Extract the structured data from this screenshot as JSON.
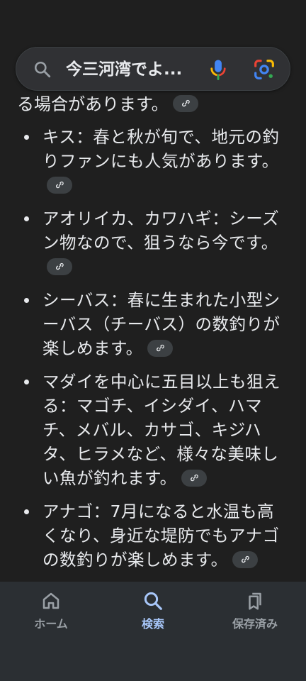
{
  "search": {
    "query": "今三河湾でよ..."
  },
  "content": {
    "previous_line": "る場合があります。",
    "bullets": [
      {
        "text": "キス：春と秋が旬で、地元の釣りファンにも人気があります。"
      },
      {
        "text": "アオリイカ、カワハギ：シーズン物なので、狙うなら今です。"
      },
      {
        "text": "シーバス：春に生まれた小型シーバス（チーバス）の数釣りが楽しめます。"
      },
      {
        "text": "マダイを中心に五目以上も狙える：マゴチ、イシダイ、ハマチ、メバル、カサゴ、キジハタ、ヒラメなど、様々な美味しい魚が釣れます。"
      },
      {
        "text": "アナゴ：7月になると水温も高くなり、身近な堤防でもアナゴの数釣りが楽しめます。"
      }
    ]
  },
  "bottom_nav": {
    "home_label": "ホーム",
    "search_label": "検索",
    "saved_label": "保存済み"
  },
  "colors": {
    "background": "#1f1f1f",
    "text": "#e8eaed",
    "link_chip": "#3c4043",
    "nav_background": "#2b2f33",
    "nav_active": "#a8c7fa",
    "nav_inactive": "#9aa0a6"
  },
  "icons": [
    "search-icon",
    "mic-icon",
    "google-lens-icon",
    "link-icon",
    "home-icon",
    "search-nav-icon",
    "saved-icon"
  ]
}
